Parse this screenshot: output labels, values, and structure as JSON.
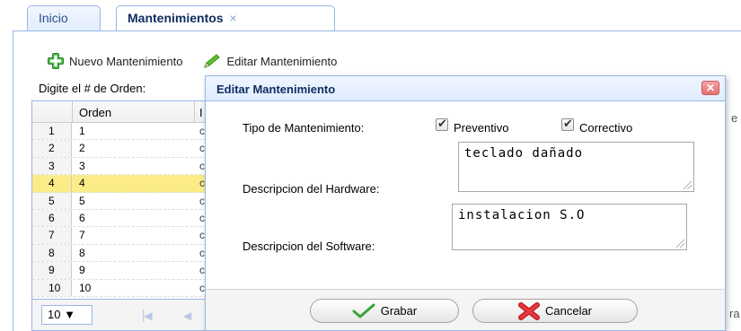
{
  "tabs": [
    {
      "label": "Inicio"
    },
    {
      "label": "Mantenimientos",
      "close": "×"
    }
  ],
  "toolbar": {
    "new_label": "Nuevo Mantenimiento",
    "edit_label": "Editar Mantenimiento"
  },
  "search": {
    "label": "Digite el # de Orden:"
  },
  "grid": {
    "header_orden": "Orden",
    "header_col3": "I",
    "rows": [
      {
        "num": "1",
        "orden": "1",
        "c3": "c"
      },
      {
        "num": "2",
        "orden": "2",
        "c3": "c"
      },
      {
        "num": "3",
        "orden": "3",
        "c3": "c"
      },
      {
        "num": "4",
        "orden": "4",
        "c3": "c"
      },
      {
        "num": "5",
        "orden": "5",
        "c3": "c"
      },
      {
        "num": "6",
        "orden": "6",
        "c3": "c"
      },
      {
        "num": "7",
        "orden": "7",
        "c3": "c"
      },
      {
        "num": "8",
        "orden": "8",
        "c3": "c"
      },
      {
        "num": "9",
        "orden": "9",
        "c3": "c"
      },
      {
        "num": "10",
        "orden": "10",
        "c3": "c"
      }
    ],
    "selected_row": 4
  },
  "pager": {
    "page_size": "10 ▼",
    "first": "▕◀",
    "prev": "◀"
  },
  "right_edge": {
    "header_frag": "e",
    "footer_frag": "ra"
  },
  "dialog": {
    "title": "Editar Mantenimiento",
    "close": "✕",
    "tipo_label": "Tipo de Mantenimiento:",
    "preventivo_label": "Preventivo",
    "preventivo_checked": true,
    "correctivo_label": "Correctivo",
    "correctivo_checked": true,
    "hardware_label": "Descripcion del Hardware:",
    "hardware_value": "teclado dañado",
    "software_label": "Descripcion del Software:",
    "software_value": "instalacion S.O",
    "save_label": "Grabar",
    "cancel_label": "Cancelar"
  },
  "colors": {
    "border": "#95b8e7",
    "title_text": "#0e2d5f",
    "selected_row": "#fbec88",
    "add_icon": "#3aa43a",
    "edit_icon": "#4caf2a",
    "cancel_icon": "#d9262c"
  },
  "icons": {
    "new": "plus-circle-icon",
    "edit": "pencil-icon",
    "save": "check-icon",
    "cancel": "x-icon",
    "close": "close-icon"
  }
}
